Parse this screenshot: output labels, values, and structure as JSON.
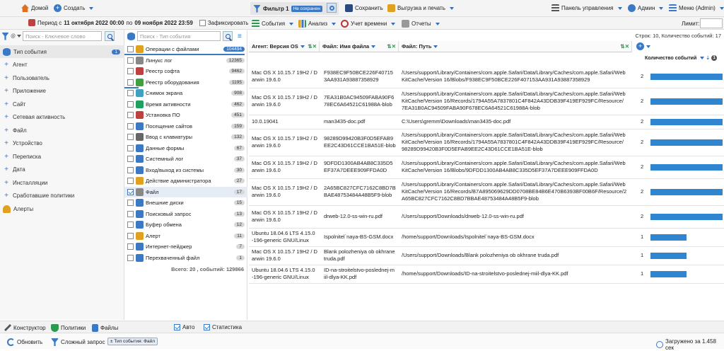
{
  "topbar": {
    "home": "Домой",
    "create": "Создать",
    "filter_label": "Фильтр 1",
    "unsaved_badge": "Не сохранен",
    "save": "Сохранить",
    "export": "Выгрузка и печать",
    "dashboard": "Панель управления",
    "admin": "Админ",
    "menu": "Меню (Admin)"
  },
  "period": {
    "prefix": "Период с",
    "from": "11 октября 2022 00:00",
    "mid": "по",
    "to": "09 ноября 2022 23:59",
    "fix_label": "Зафиксировать"
  },
  "toolbar": {
    "events": "События",
    "analysis": "Анализ",
    "time": "Учет времени",
    "reports": "Отчеты",
    "limit_label": "Лимит:"
  },
  "left": {
    "search_placeholder": "Поиск - Ключевое слово",
    "categories": [
      {
        "label": "Тип события",
        "badge": "1"
      },
      {
        "label": "Агент"
      },
      {
        "label": "Пользователь"
      },
      {
        "label": "Приложение"
      },
      {
        "label": "Сайт"
      },
      {
        "label": "Сетевая активность"
      },
      {
        "label": "Файл"
      },
      {
        "label": "Устройство"
      },
      {
        "label": "Переписка"
      },
      {
        "label": "Дата"
      },
      {
        "label": "Инсталляции"
      },
      {
        "label": "Сработавшие политики"
      },
      {
        "label": "Алерты"
      }
    ]
  },
  "mid": {
    "search_placeholder": "Поиск - Тип события",
    "events": [
      {
        "label": "Операции с файлами",
        "count": "104494",
        "color": "#e0a020"
      },
      {
        "label": "Линукс лог",
        "count": "12365",
        "color": "#888888"
      },
      {
        "label": "Реестр софта",
        "count": "9462",
        "color": "#c04040"
      },
      {
        "label": "Реестр оборудования",
        "count": "1195",
        "color": "#40a040"
      },
      {
        "label": "Снимок экрана",
        "count": "908",
        "color": "#40a0c0"
      },
      {
        "label": "Время активности",
        "count": "462",
        "color": "#20a060"
      },
      {
        "label": "Установка ПО",
        "count": "451",
        "color": "#c04040"
      },
      {
        "label": "Посещение сайтов",
        "count": "159",
        "color": "#3b79c5"
      },
      {
        "label": "Ввод с клавиатуры",
        "count": "132",
        "color": "#666666"
      },
      {
        "label": "Данные формы",
        "count": "67",
        "color": "#3b79c5"
      },
      {
        "label": "Системный лог",
        "count": "37",
        "color": "#3b79c5"
      },
      {
        "label": "Вход/выход из системы",
        "count": "30",
        "color": "#3b79c5"
      },
      {
        "label": "Действие администратора",
        "count": "27",
        "color": "#e0a020"
      },
      {
        "label": "Файл",
        "count": "17",
        "color": "#888888"
      },
      {
        "label": "Внешние диски",
        "count": "15",
        "color": "#3b79c5"
      },
      {
        "label": "Поисковый запрос",
        "count": "13",
        "color": "#3b79c5"
      },
      {
        "label": "Буфер обмена",
        "count": "12",
        "color": "#3b79c5"
      },
      {
        "label": "Алерт",
        "count": "11",
        "color": "#e0a020"
      },
      {
        "label": "Интернет-пейджер",
        "count": "7",
        "color": "#3b79c5"
      },
      {
        "label": "Перехваченный файл",
        "count": "1",
        "color": "#3b79c5"
      }
    ],
    "total": "Всего: 20 , событий: 129866"
  },
  "table": {
    "summary": "Строк: 10, Количество событий: 17",
    "headers": {
      "agent": "Агент: Версия OS",
      "filename": "Файл: Имя файла",
      "path": "Файл: Путь",
      "count": "Количество событий"
    },
    "rows": [
      {
        "agent": [
          "Mac OS X 10.15.7 19H2 / D",
          "arwin 19.6.0"
        ],
        "file": [
          "F938EC9F50BCE226F40715",
          "3AA931A93887358929"
        ],
        "path": [
          "/Users/support/Library/Containers/com.apple.Safari/Data/Library/Caches/com.apple.Safari/Web",
          "KitCache/Version 16/Blobs/F938EC9F50BCE226F407153AA931A93887358929"
        ],
        "count": "2",
        "value": 2
      },
      {
        "agent": [
          "Mac OS X 10.15.7 19H2 / D",
          "arwin 19.6.0"
        ],
        "file": [
          "7EA31B0AC94509FABA90F6",
          "78EC6A64521C61988A-blob"
        ],
        "path": [
          "/Users/support/Library/Containers/com.apple.Safari/Data/Library/Caches/com.apple.Safari/Web",
          "KitCache/Version 16/Records/1794A55A7837801C4F842A43DDB39F419EF929FC/Resource/",
          "7EA31B0AC94509FABA90F678EC6A64521C61988A-blob"
        ],
        "count": "2",
        "value": 2
      },
      {
        "agent": [
          "10.0.19041"
        ],
        "file": [
          "man3435-doc.pdf"
        ],
        "path": [
          "C:\\Users\\gremm\\Downloads\\man3435-doc.pdf"
        ],
        "count": "2",
        "value": 2
      },
      {
        "agent": [
          "Mac OS X 10.15.7 19H2 / D",
          "arwin 19.6.0"
        ],
        "file": [
          "98289D99420B3F0D5EFAB9",
          "EE2C43D61CCE1BA51E-blob"
        ],
        "path": [
          "/Users/support/Library/Containers/com.apple.Safari/Data/Library/Caches/com.apple.Safari/Web",
          "KitCache/Version 16/Records/1794A55A7837801C4F842A43DDB39F419EF929FC/Resource/",
          "98289D99420B3F0D5EFAB9EE2C43D61CCE1BA51E-blob"
        ],
        "count": "2",
        "value": 2
      },
      {
        "agent": [
          "Mac OS X 10.15.7 19H2 / D",
          "arwin 19.6.0"
        ],
        "file": [
          "9DFDD1300AB4AB8C335D5",
          "EF37A7DEEE909FFDA0D"
        ],
        "path": [
          "/Users/support/Library/Containers/com.apple.Safari/Data/Library/Caches/com.apple.Safari/Web",
          "KitCache/Version 16/Blobs/9DFDD1300AB4AB8C335D5EF37A7DEEE909FFDA0D"
        ],
        "count": "2",
        "value": 2
      },
      {
        "agent": [
          "Mac OS X 10.15.7 19H2 / D",
          "arwin 19.6.0"
        ],
        "file": [
          "2A65BC827CFC7162C8BD7B",
          "BAE48753484A48B5F9-blob"
        ],
        "path": [
          "/Users/support/Library/Containers/com.apple.Safari/Data/Library/Caches/com.apple.Safari/Web",
          "KitCache/Version 16/Records/B7A895069629DD0708BE84B6E470B6393BF00B6F/Resource/2",
          "A65BC827CFC7162C8BD7BBAE48753484A48B5F9-blob"
        ],
        "count": "2",
        "value": 2
      },
      {
        "agent": [
          "Mac OS X 10.15.7 19H2 / D",
          "arwin 19.6.0"
        ],
        "file": [
          "drweb-12.0-ss-win-ru.pdf"
        ],
        "path": [
          "/Users/support/Downloads/drweb-12.0-ss-win-ru.pdf"
        ],
        "count": "2",
        "value": 2
      },
      {
        "agent": [
          "Ubuntu 18.04.6 LTS 4.15.0",
          "-196-generic GNU/Linux"
        ],
        "file": [
          "Ispolnitel`naya-BS-GSM.docx"
        ],
        "path": [
          "/home/support/Downloads/Ispolnitel`naya-BS-GSM.docx"
        ],
        "count": "1",
        "value": 1
      },
      {
        "agent": [
          "Mac OS X 10.15.7 19H2 / D",
          "arwin 19.6.0"
        ],
        "file": [
          "Blank polozheniya ob okhrane",
          "truda.pdf"
        ],
        "path": [
          "/Users/support/Downloads/Blank polozheniya ob okhrane truda.pdf"
        ],
        "count": "1",
        "value": 1
      },
      {
        "agent": [
          "Ubuntu 18.04.6 LTS 4.15.0",
          "-196-generic GNU/Linux"
        ],
        "file": [
          "ID-na-stroitelstvo-poslednej-m",
          "iil-dlya-KK.pdf"
        ],
        "path": [
          "/home/support/Downloads/ID-na-stroitelstvo-poslednej-miil-dlya-KK.pdf"
        ],
        "count": "1",
        "value": 1
      }
    ]
  },
  "tabs": {
    "constructor": "Конструктор",
    "policies": "Политики",
    "files": "Файлы",
    "auto": "Авто",
    "stats": "Статистика"
  },
  "status": {
    "refresh": "Обновить",
    "complex": "Сложный запрос",
    "tag": "± Тип события: Файл",
    "loaded": "Загружено за 1.458 сек"
  },
  "colors": {
    "accent": "#3b79c5",
    "bar": "#2f85d0"
  }
}
